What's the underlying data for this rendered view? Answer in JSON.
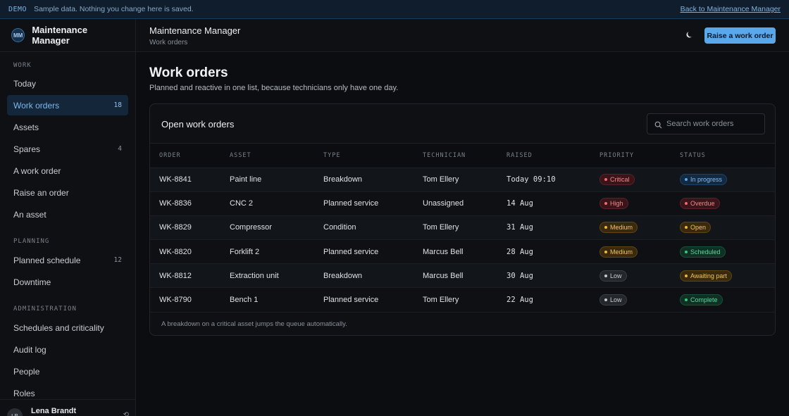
{
  "banner": {
    "tag": "DEMO",
    "message": "Sample data. Nothing you change here is saved.",
    "back_link": "Back to Maintenance Manager"
  },
  "brand": {
    "initials": "MM",
    "name": "Maintenance Manager"
  },
  "sidebar": {
    "sections": [
      {
        "title": "WORK",
        "items": [
          {
            "label": "Today",
            "count": ""
          },
          {
            "label": "Work orders",
            "count": "18",
            "active": true
          },
          {
            "label": "Assets",
            "count": ""
          },
          {
            "label": "Spares",
            "count": "4"
          },
          {
            "label": "A work order",
            "count": ""
          },
          {
            "label": "Raise an order",
            "count": ""
          },
          {
            "label": "An asset",
            "count": ""
          }
        ]
      },
      {
        "title": "PLANNING",
        "items": [
          {
            "label": "Planned schedule",
            "count": "12"
          },
          {
            "label": "Downtime",
            "count": ""
          }
        ]
      },
      {
        "title": "ADMINISTRATION",
        "items": [
          {
            "label": "Schedules and criticality",
            "count": ""
          },
          {
            "label": "Audit log",
            "count": ""
          },
          {
            "label": "People",
            "count": ""
          },
          {
            "label": "Roles",
            "count": ""
          }
        ]
      }
    ],
    "user": {
      "initials": "LB",
      "name": "Lena Brandt"
    }
  },
  "header": {
    "title": "Maintenance Manager",
    "subtitle": "Work orders",
    "theme_icon": "moon-icon",
    "primary_button": "Raise a work order"
  },
  "page": {
    "title": "Work orders",
    "description": "Planned and reactive in one list, because technicians only have one day."
  },
  "card": {
    "title": "Open work orders",
    "search_placeholder": "Search work orders",
    "columns": [
      "ORDER",
      "ASSET",
      "TYPE",
      "TECHNICIAN",
      "RAISED",
      "PRIORITY",
      "STATUS"
    ],
    "rows": [
      {
        "order": "WK-8841",
        "asset": "Paint line",
        "type": "Breakdown",
        "technician": "Tom Ellery",
        "raised": "Today 09:10",
        "priority": "Critical",
        "status": "In progress"
      },
      {
        "order": "WK-8836",
        "asset": "CNC 2",
        "type": "Planned service",
        "technician": "Unassigned",
        "raised": "14 Aug",
        "priority": "High",
        "status": "Overdue"
      },
      {
        "order": "WK-8829",
        "asset": "Compressor",
        "type": "Condition",
        "technician": "Tom Ellery",
        "raised": "31 Aug",
        "priority": "Medium",
        "status": "Open"
      },
      {
        "order": "WK-8820",
        "asset": "Forklift 2",
        "type": "Planned service",
        "technician": "Marcus Bell",
        "raised": "28 Aug",
        "priority": "Medium",
        "status": "Scheduled"
      },
      {
        "order": "WK-8812",
        "asset": "Extraction unit",
        "type": "Breakdown",
        "technician": "Marcus Bell",
        "raised": "30 Aug",
        "priority": "Low",
        "status": "Awaiting part"
      },
      {
        "order": "WK-8790",
        "asset": "Bench 1",
        "type": "Planned service",
        "technician": "Tom Ellery",
        "raised": "22 Aug",
        "priority": "Low",
        "status": "Complete"
      }
    ],
    "footer": "A breakdown on a critical asset jumps the queue automatically."
  },
  "colors": {
    "accent": "#5aa8ec",
    "background": "#0b0d10",
    "critical": "#f06b72",
    "warning": "#f0b53c",
    "success": "#3ec47f"
  }
}
